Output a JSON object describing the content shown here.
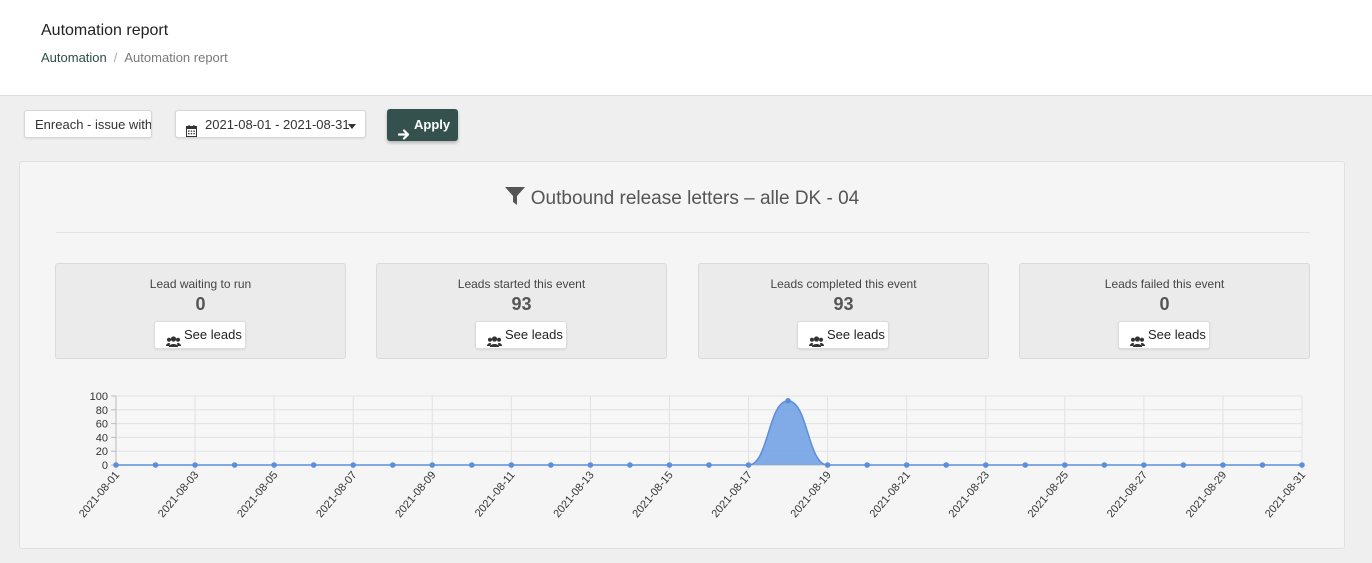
{
  "header": {
    "title": "Automation report",
    "breadcrumb": {
      "link": "Automation",
      "separator": "/",
      "current": "Automation report"
    }
  },
  "filters": {
    "automation_select": "Enreach - issue with",
    "date_range": "2021-08-01 - 2021-08-31",
    "apply_label": "Apply"
  },
  "panel": {
    "title": "Outbound release letters – alle DK - 04",
    "stats": [
      {
        "label": "Lead waiting to run",
        "value": "0",
        "button": "See leads"
      },
      {
        "label": "Leads started this event",
        "value": "93",
        "button": "See leads"
      },
      {
        "label": "Leads completed this event",
        "value": "93",
        "button": "See leads"
      },
      {
        "label": "Leads failed this event",
        "value": "0",
        "button": "See leads"
      }
    ]
  },
  "colors": {
    "accent": "#34514d",
    "series_fill": "#7aa6e6",
    "series_line": "#5b8fd9"
  },
  "chart_data": {
    "type": "area",
    "x": [
      "2021-08-01",
      "2021-08-02",
      "2021-08-03",
      "2021-08-04",
      "2021-08-05",
      "2021-08-06",
      "2021-08-07",
      "2021-08-08",
      "2021-08-09",
      "2021-08-10",
      "2021-08-11",
      "2021-08-12",
      "2021-08-13",
      "2021-08-14",
      "2021-08-15",
      "2021-08-16",
      "2021-08-17",
      "2021-08-18",
      "2021-08-19",
      "2021-08-20",
      "2021-08-21",
      "2021-08-22",
      "2021-08-23",
      "2021-08-24",
      "2021-08-25",
      "2021-08-26",
      "2021-08-27",
      "2021-08-28",
      "2021-08-29",
      "2021-08-30",
      "2021-08-31"
    ],
    "x_tick_labels": [
      "2021-08-01",
      "2021-08-03",
      "2021-08-05",
      "2021-08-07",
      "2021-08-09",
      "2021-08-11",
      "2021-08-13",
      "2021-08-15",
      "2021-08-17",
      "2021-08-19",
      "2021-08-21",
      "2021-08-23",
      "2021-08-25",
      "2021-08-27",
      "2021-08-29",
      "2021-08-31"
    ],
    "series": [
      {
        "values": [
          0,
          0,
          0,
          0,
          0,
          0,
          0,
          0,
          0,
          0,
          0,
          0,
          0,
          0,
          0,
          0,
          0,
          93,
          0,
          0,
          0,
          0,
          0,
          0,
          0,
          0,
          0,
          0,
          0,
          0,
          0
        ]
      }
    ],
    "y_ticks": [
      0,
      20,
      40,
      60,
      80,
      100
    ],
    "ylim": [
      0,
      100
    ],
    "grid": true,
    "legend": "none"
  }
}
